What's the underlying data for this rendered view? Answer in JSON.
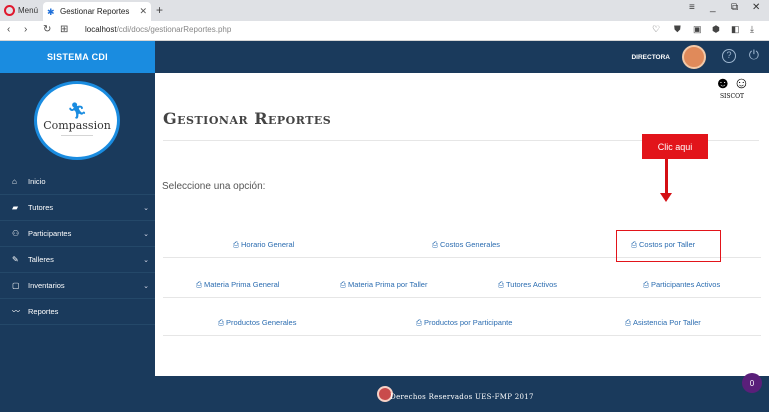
{
  "browser": {
    "menu_label": "Menú",
    "tab_title": "Gestionar Reportes",
    "tab_close": "✕",
    "new_tab": "+",
    "url_host": "localhost",
    "url_path": "/cdi/docs/gestionarReportes.php"
  },
  "sidebar": {
    "brand": "SISTEMA CDI",
    "logo_text": "Compassion",
    "items": [
      {
        "label": "Inicio",
        "icon": "home-icon",
        "has_submenu": false
      },
      {
        "label": "Tutores",
        "icon": "briefcase-icon",
        "has_submenu": true
      },
      {
        "label": "Participantes",
        "icon": "users-icon",
        "has_submenu": true
      },
      {
        "label": "Talleres",
        "icon": "wrench-icon",
        "has_submenu": true
      },
      {
        "label": "Inventarios",
        "icon": "clipboard-icon",
        "has_submenu": true
      },
      {
        "label": "Reportes",
        "icon": "chart-line-icon",
        "has_submenu": false
      }
    ]
  },
  "topbar": {
    "role": "DIRECTORA"
  },
  "main": {
    "title": "Gestionar Reportes",
    "siscot_label": "SISCOT",
    "callout": "Clic aqui",
    "prompt": "Seleccione una opción:",
    "rows": [
      [
        "Horario General",
        "Costos Generales",
        "Costos por Taller"
      ],
      [
        "Materia Prima General",
        "Materia Prima por Taller",
        "Tutores Activos",
        "Participantes Activos"
      ],
      [
        "Productos Generales",
        "Productos por Participante",
        "Asistencia Por Taller"
      ]
    ]
  },
  "footer": {
    "text": "Derechos Reservados UES-FMP 2017"
  },
  "notification_count": "0",
  "colors": {
    "navy": "#1a3a5c",
    "accent_blue": "#1a8ce0",
    "link": "#2b6cb0",
    "callout_red": "#e2141a"
  }
}
